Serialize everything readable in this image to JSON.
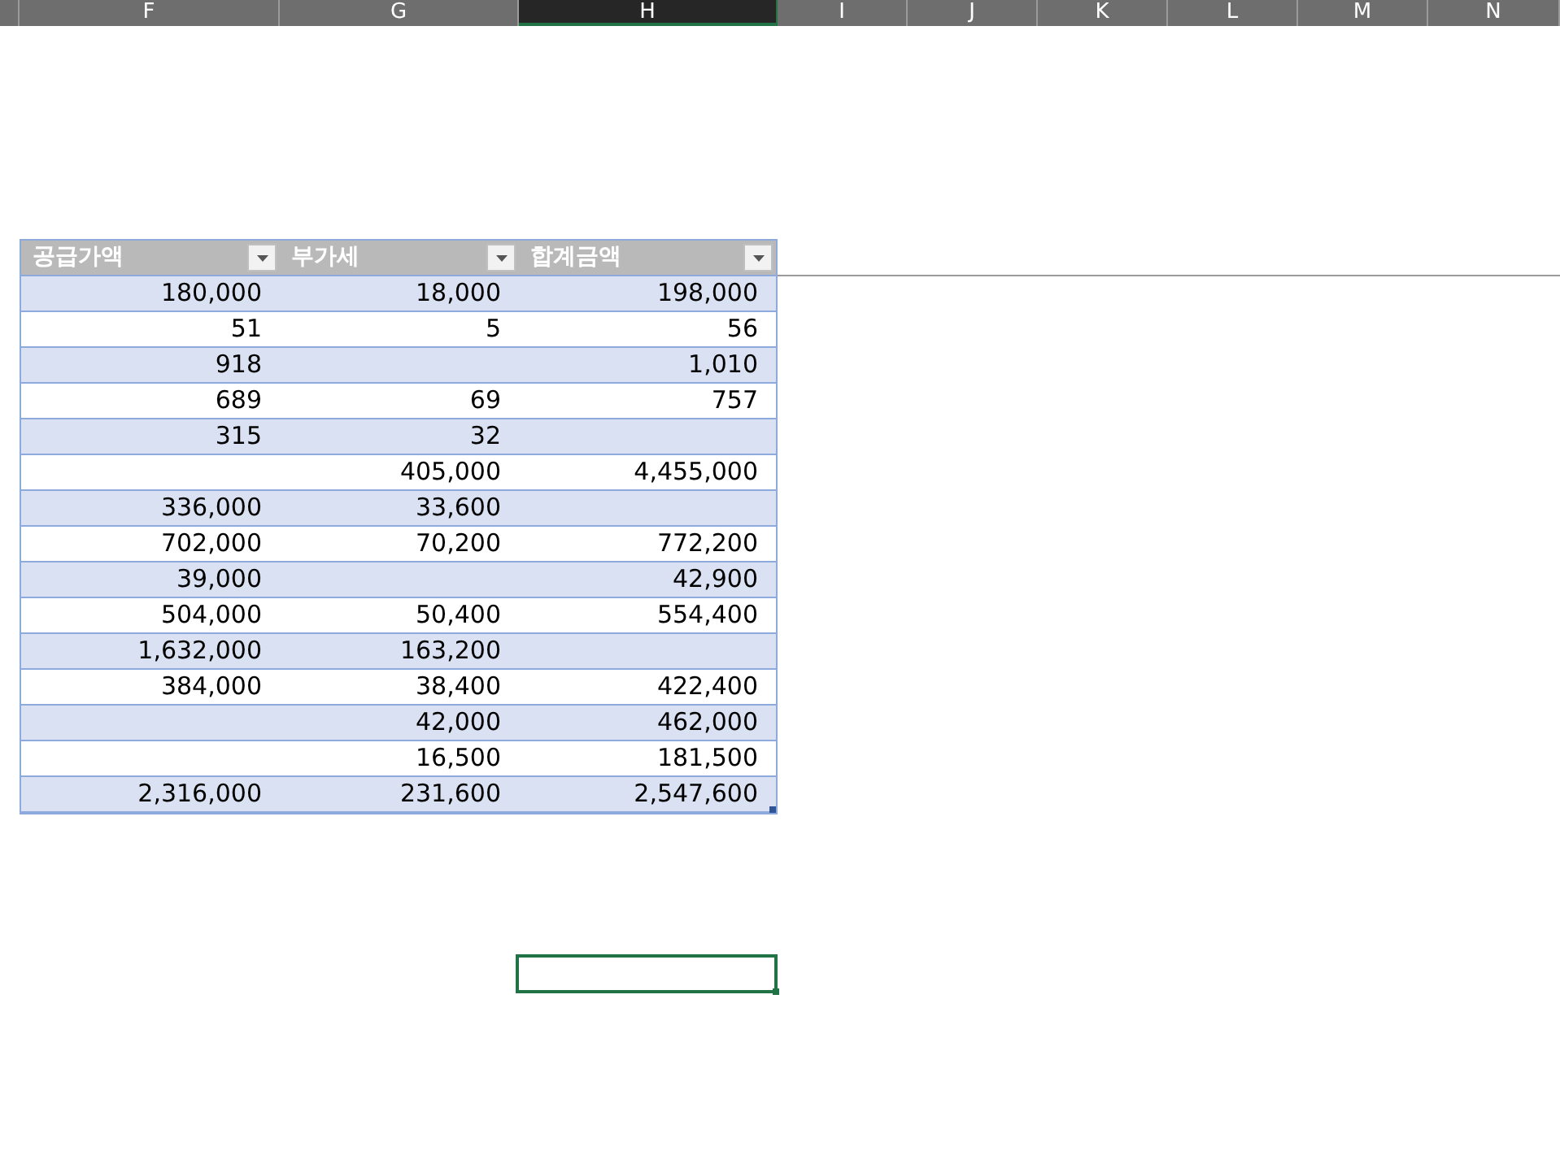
{
  "column_headers": [
    {
      "label": "F",
      "selected": false
    },
    {
      "label": "G",
      "selected": false
    },
    {
      "label": "H",
      "selected": true
    },
    {
      "label": "I",
      "selected": false
    },
    {
      "label": "J",
      "selected": false
    },
    {
      "label": "K",
      "selected": false
    },
    {
      "label": "L",
      "selected": false
    },
    {
      "label": "M",
      "selected": false
    },
    {
      "label": "N",
      "selected": false
    }
  ],
  "table": {
    "banded": true,
    "columns": [
      {
        "label": "공급가액",
        "filter": true
      },
      {
        "label": "부가세",
        "filter": true
      },
      {
        "label": "합계금액",
        "filter": true
      }
    ],
    "rows": [
      {
        "supply": "180,000",
        "vat": "18,000",
        "total": "198,000"
      },
      {
        "supply": "51",
        "vat": "5",
        "total": "56"
      },
      {
        "supply": "918",
        "total": "1,010"
      },
      {
        "supply": "689",
        "vat": "69",
        "total": "757"
      },
      {
        "supply": "315",
        "vat": "32"
      },
      {
        "vat": "405,000",
        "total": "4,455,000"
      },
      {
        "supply": "336,000",
        "vat": "33,600"
      },
      {
        "supply": "702,000",
        "vat": "70,200",
        "total": "772,200"
      },
      {
        "supply": "39,000",
        "total": "42,900"
      },
      {
        "supply": "504,000",
        "vat": "50,400",
        "total": "554,400"
      },
      {
        "supply": "1,632,000",
        "vat": "163,200"
      },
      {
        "supply": "384,000",
        "vat": "38,400",
        "total": "422,400"
      },
      {
        "vat": "42,000",
        "total": "462,000"
      },
      {
        "vat": "16,500",
        "total": "181,500"
      },
      {
        "supply": "2,316,000",
        "vat": "231,600",
        "total": "2,547,600"
      }
    ]
  }
}
